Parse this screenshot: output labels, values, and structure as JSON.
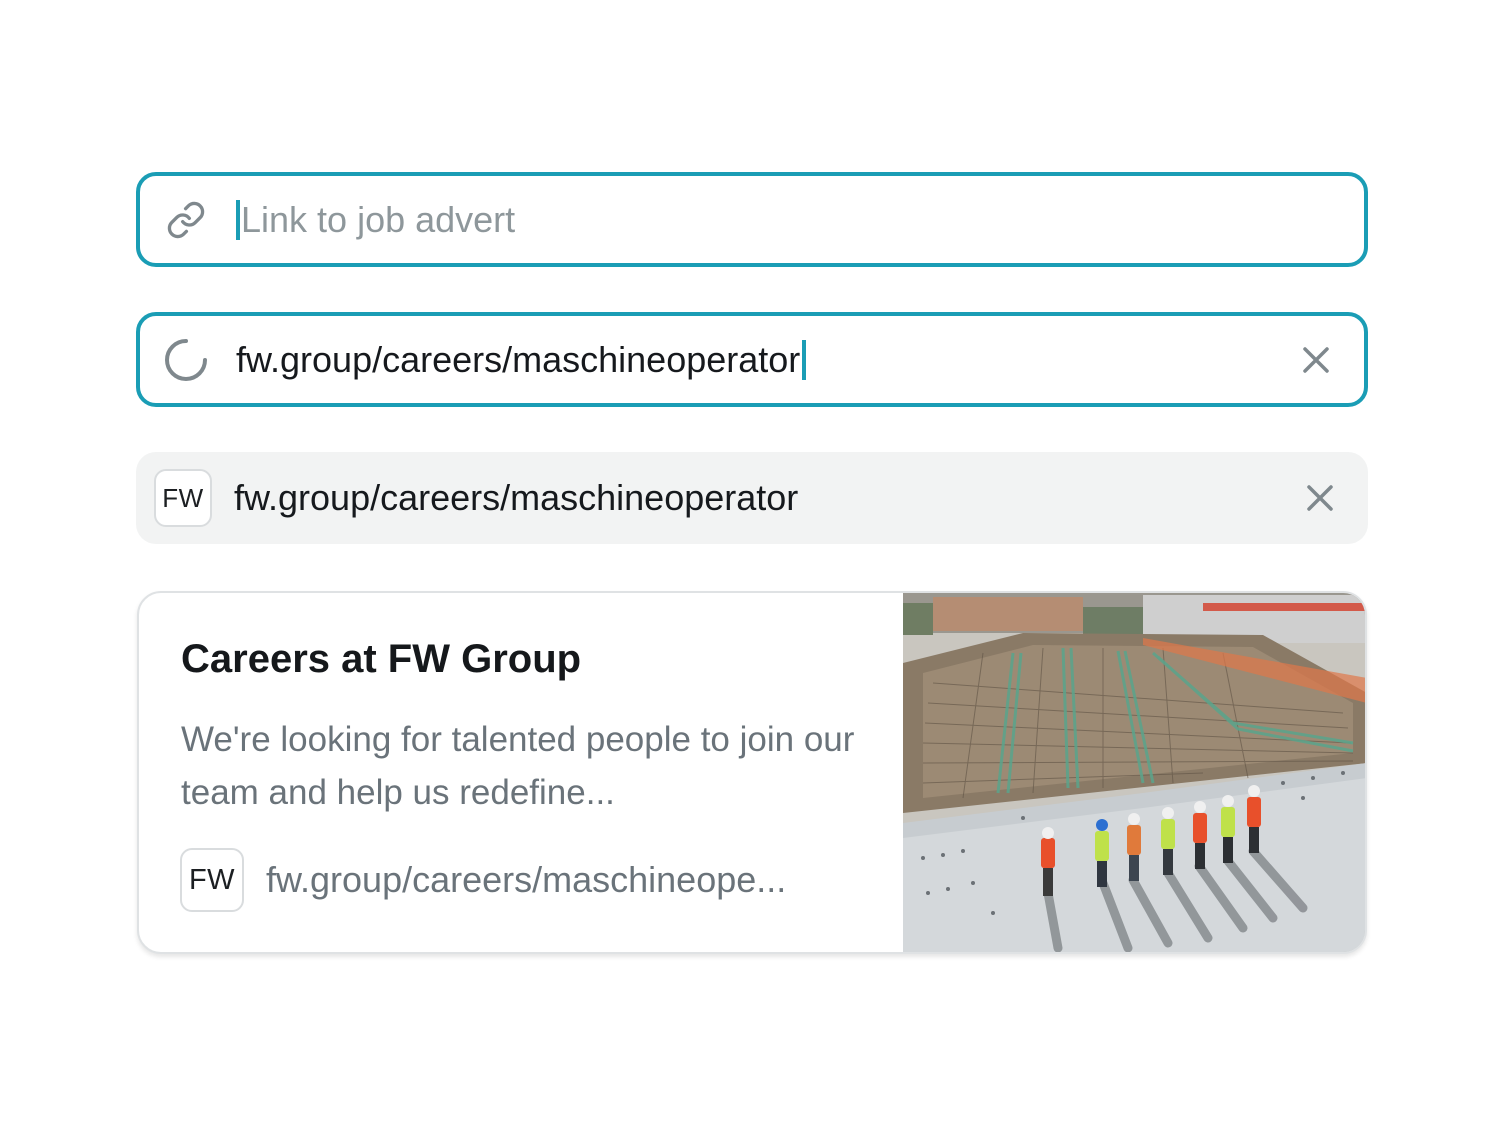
{
  "fields": {
    "empty": {
      "placeholder": "Link to job advert",
      "icon": "link-icon"
    },
    "loading": {
      "value": "fw.group/careers/maschineoperator",
      "icon": "spinner-icon",
      "clear_icon": "close-icon"
    },
    "filled": {
      "value": "fw.group/careers/maschineoperator",
      "favicon_text": "FW",
      "clear_icon": "close-icon"
    }
  },
  "preview": {
    "title": "Careers at FW Group",
    "description": "We're looking for talented people to join our team and help us redefine...",
    "favicon_text": "FW",
    "url": "fw.group/careers/maschineope...",
    "image": "construction-site-photo"
  },
  "colors": {
    "accent": "#1a9db5",
    "filled_background": "#f2f3f3",
    "muted_text": "#6a737a",
    "placeholder_text": "#8e979b"
  }
}
